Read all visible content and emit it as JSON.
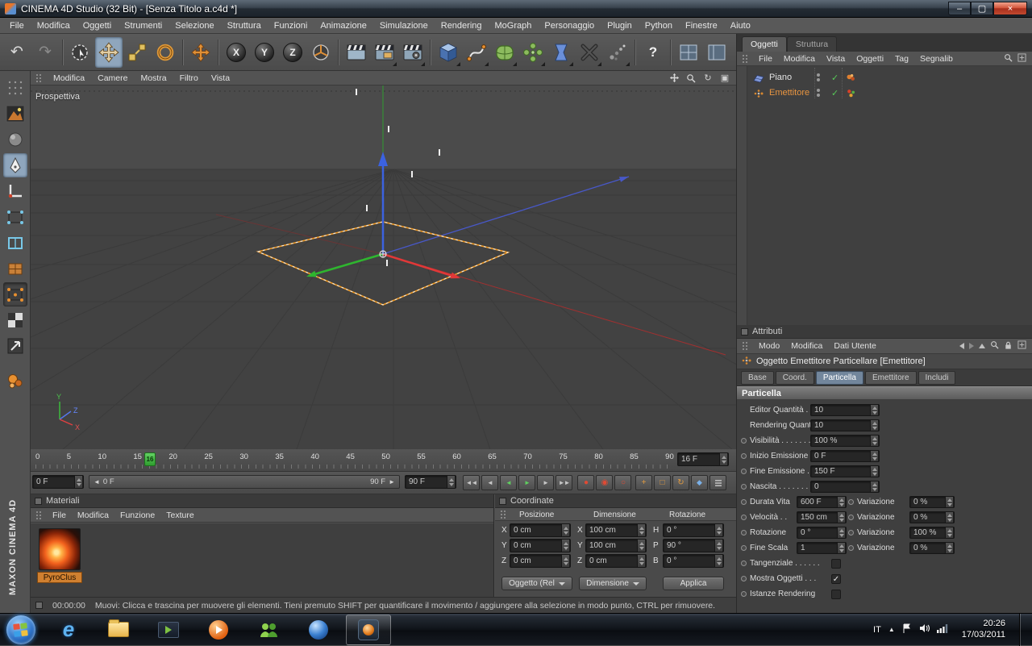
{
  "window": {
    "title": "CINEMA 4D Studio (32 Bit) - [Senza Titolo a.c4d *]"
  },
  "glyphs": {
    "minimize": "–",
    "maximize": "▢",
    "close": "×",
    "undo": "↶",
    "redo": "↷",
    "help": "?",
    "check": "✓",
    "left": "◄",
    "right": "►",
    "goto_start": "◄◄",
    "prev_frame": "◄",
    "play_reverse": "◄",
    "play": "►",
    "next_frame": "►",
    "goto_end": "►►",
    "record": "●",
    "autokey": "◉",
    "keyframe": "○",
    "key_position": "+",
    "key_scale": "□",
    "key_rotation": "↻",
    "key_parameter": "◆",
    "rotate_view": "↻",
    "toggle_view": "▣",
    "hidden_icons": "▲"
  },
  "menubar": {
    "items": [
      "File",
      "Modifica",
      "Oggetti",
      "Strumenti",
      "Selezione",
      "Struttura",
      "Funzioni",
      "Animazione",
      "Simulazione",
      "Rendering",
      "MoGraph",
      "Personaggio",
      "Plugin",
      "Python",
      "Finestre",
      "Aiuto"
    ]
  },
  "toolbar": {
    "axis": [
      "X",
      "Y",
      "Z"
    ]
  },
  "viewport": {
    "label": "Prospettiva",
    "menu": [
      "Modifica",
      "Camere",
      "Mostra",
      "Filtro",
      "Vista"
    ],
    "axis": {
      "x": "X",
      "y": "Y",
      "z": "Z"
    }
  },
  "timeline": {
    "ticks": [
      "0",
      "5",
      "10",
      "15",
      "20",
      "25",
      "30",
      "35",
      "40",
      "45",
      "50",
      "55",
      "60",
      "65",
      "70",
      "75",
      "80",
      "85",
      "90"
    ],
    "marker": "16",
    "current": "16 F",
    "start": "0 F",
    "range_start": "0 F",
    "range_end": "90 F",
    "end": "90 F"
  },
  "materials": {
    "title": "Materiali",
    "menu": [
      "File",
      "Modifica",
      "Funzione",
      "Texture"
    ],
    "items": [
      {
        "name": "PyroClus"
      }
    ]
  },
  "coordinates": {
    "title": "Coordinate",
    "headers": [
      "Posizione",
      "Dimensione",
      "Rotazione"
    ],
    "rows": [
      {
        "l1": "X",
        "v1": "0 cm",
        "l2": "X",
        "v2": "100 cm",
        "l3": "H",
        "v3": "0 °"
      },
      {
        "l1": "Y",
        "v1": "0 cm",
        "l2": "Y",
        "v2": "100 cm",
        "l3": "P",
        "v3": "90 °"
      },
      {
        "l1": "Z",
        "v1": "0 cm",
        "l2": "Z",
        "v2": "0 cm",
        "l3": "B",
        "v3": "0 °"
      }
    ],
    "buttons": {
      "mode": "Oggetto (Rel",
      "dim": "Dimensione",
      "apply": "Applica"
    }
  },
  "objects": {
    "tabs": [
      "Oggetti",
      "Struttura"
    ],
    "menu": [
      "File",
      "Modifica",
      "Vista",
      "Oggetti",
      "Tag",
      "Segnalib"
    ],
    "items": [
      {
        "name": "Piano"
      },
      {
        "name": "Emettitore"
      }
    ]
  },
  "attributes": {
    "title": "Attributi",
    "menu": [
      "Modo",
      "Modifica",
      "Dati Utente"
    ],
    "object_title": "Oggetto Emettitore Particellare [Emettitore]",
    "tabs": [
      "Base",
      "Coord.",
      "Particella",
      "Emettitore",
      "Includi"
    ],
    "section": "Particella",
    "rows": [
      {
        "label": "Editor Quantità . . . .",
        "value": "10"
      },
      {
        "label": "Rendering Quantità",
        "value": "10"
      },
      {
        "label": "Visibilità . . . . . . . . .",
        "value": "100 %"
      },
      {
        "label": "Inizio Emissione . . .",
        "value": "0 F"
      },
      {
        "label": "Fine Emissione . . . .",
        "value": "150 F"
      },
      {
        "label": "Nascita . . . . . . . . . .",
        "value": "0"
      },
      {
        "label": "Durata Vita",
        "value": "600 F",
        "var_label": "Variazione",
        "var_value": "0 %"
      },
      {
        "label": "Velocità . .",
        "value": "150 cm",
        "var_label": "Variazione",
        "var_value": "0 %"
      },
      {
        "label": "Rotazione",
        "value": "0 °",
        "var_label": "Variazione",
        "var_value": "100 %"
      },
      {
        "label": "Fine Scala",
        "value": "1",
        "var_label": "Variazione",
        "var_value": "0 %"
      },
      {
        "label": "Tangenziale . . . . . .",
        "checked": false
      },
      {
        "label": "Mostra Oggetti . . .",
        "checked": true
      },
      {
        "label": "Istanze Rendering",
        "checked": false
      }
    ]
  },
  "statusbar": {
    "time": "00:00:00",
    "message": "Muovi: Clicca e trascina per muovere gli elementi. Tieni premuto SHIFT per quantificare il movimento / aggiungere alla selezione in modo punto, CTRL per rimuovere."
  },
  "taskbar": {
    "language": "IT",
    "clock_time": "20:26",
    "clock_date": "17/03/2011"
  },
  "branding": {
    "text": "MAXON CINEMA 4D"
  }
}
